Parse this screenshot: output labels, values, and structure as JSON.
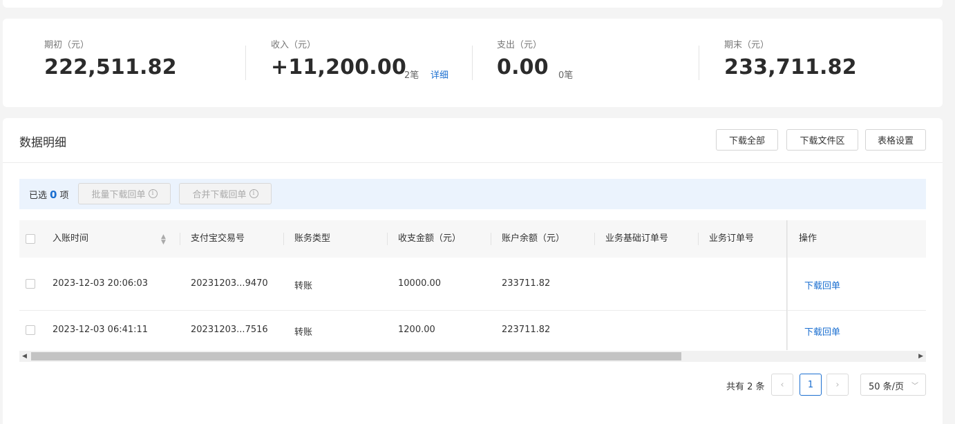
{
  "summary": {
    "opening": {
      "label": "期初（元）",
      "value": "222,511.82"
    },
    "income": {
      "label": "收入（元）",
      "value": "+11,200.00",
      "count": "2笔",
      "link": "详细"
    },
    "expense": {
      "label": "支出（元）",
      "value": "0.00",
      "count": "0笔"
    },
    "closing": {
      "label": "期末（元）",
      "value": "233,711.82"
    }
  },
  "detail": {
    "title": "数据明细",
    "buttons": {
      "download_all": "下载全部",
      "download_area": "下载文件区",
      "table_settings": "表格设置"
    },
    "selection": {
      "prefix": "已选",
      "count": "0",
      "suffix": "项",
      "batch_download": "批量下载回单",
      "merge_download": "合并下载回单",
      "info_icon": "info-icon"
    }
  },
  "table": {
    "columns": [
      "入账时间",
      "支付宝交易号",
      "账务类型",
      "收支金额（元）",
      "账户余额（元）",
      "业务基础订单号",
      "业务订单号",
      "操作"
    ],
    "rows": [
      {
        "time": "2023-12-03 20:06:03",
        "trade_no": "20231203...9470",
        "type": "转账",
        "amount": "10000.00",
        "balance": "233711.82",
        "base_order": "",
        "order": "",
        "action": "下载回单"
      },
      {
        "time": "2023-12-03 06:41:11",
        "trade_no": "20231203...7516",
        "type": "转账",
        "amount": "1200.00",
        "balance": "223711.82",
        "base_order": "",
        "order": "",
        "action": "下载回单"
      }
    ]
  },
  "pagination": {
    "total": "共有 2 条",
    "current_page": "1",
    "page_size": "50 条/页",
    "prev_icon": "chevron-left-icon",
    "next_icon": "chevron-right-icon"
  },
  "colors": {
    "accent": "#1b6fd0",
    "selection_bg": "#ebf3fd"
  }
}
